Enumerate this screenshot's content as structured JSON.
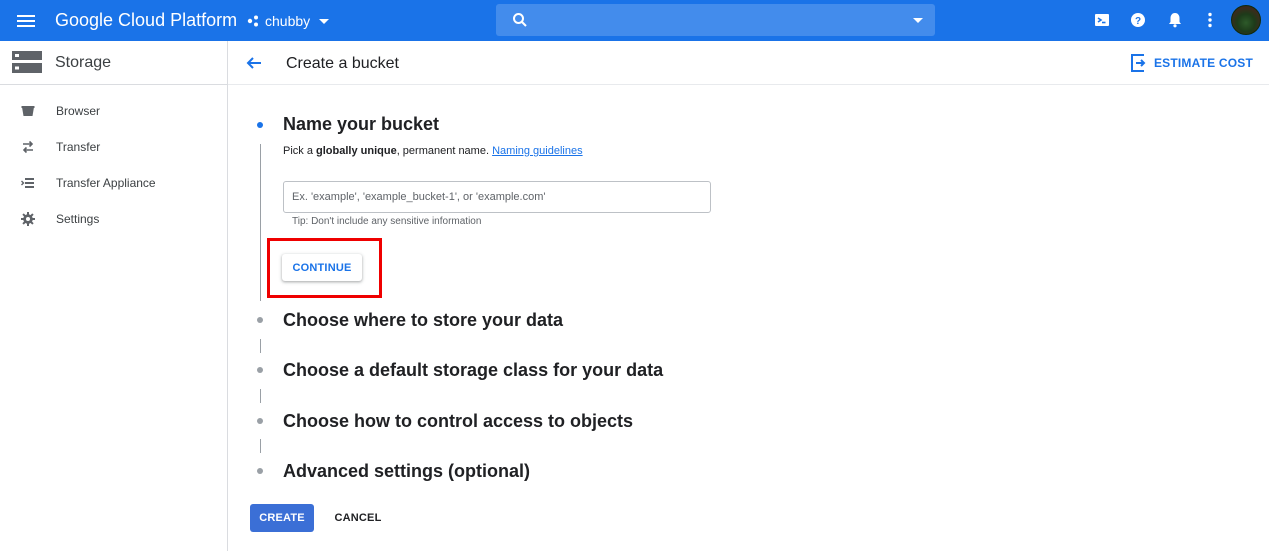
{
  "topbar": {
    "brand": "Google Cloud Platform",
    "project": "chubby",
    "search_placeholder": "",
    "icons": [
      "menu-icon",
      "project-icon",
      "search-icon",
      "cloud-shell-icon",
      "help-icon",
      "notifications-icon",
      "more-vert-icon",
      "avatar"
    ]
  },
  "sidebar": {
    "title": "Storage",
    "items": [
      {
        "label": "Browser",
        "icon": "bucket-icon"
      },
      {
        "label": "Transfer",
        "icon": "transfer-icon"
      },
      {
        "label": "Transfer Appliance",
        "icon": "transfer-appliance-icon"
      },
      {
        "label": "Settings",
        "icon": "gear-icon"
      }
    ]
  },
  "header": {
    "title": "Create a bucket",
    "estimate_cost": "ESTIMATE COST"
  },
  "steps": {
    "name": {
      "title": "Name your bucket",
      "desc_prefix": "Pick a ",
      "desc_bold": "globally unique",
      "desc_suffix": ", permanent name.",
      "link": "Naming guidelines",
      "input_placeholder": "Ex. 'example', 'example_bucket-1', or 'example.com'",
      "tip": "Tip: Don't include any sensitive information",
      "continue": "CONTINUE"
    },
    "location": {
      "title": "Choose where to store your data"
    },
    "storage_class": {
      "title": "Choose a default storage class for your data"
    },
    "access": {
      "title": "Choose how to control access to objects"
    },
    "advanced": {
      "title": "Advanced settings (optional)"
    }
  },
  "actions": {
    "create": "CREATE",
    "cancel": "CANCEL"
  },
  "colors": {
    "primary": "#1a73e8",
    "highlight": "#ef0000",
    "create_button": "#3b6fd6"
  }
}
